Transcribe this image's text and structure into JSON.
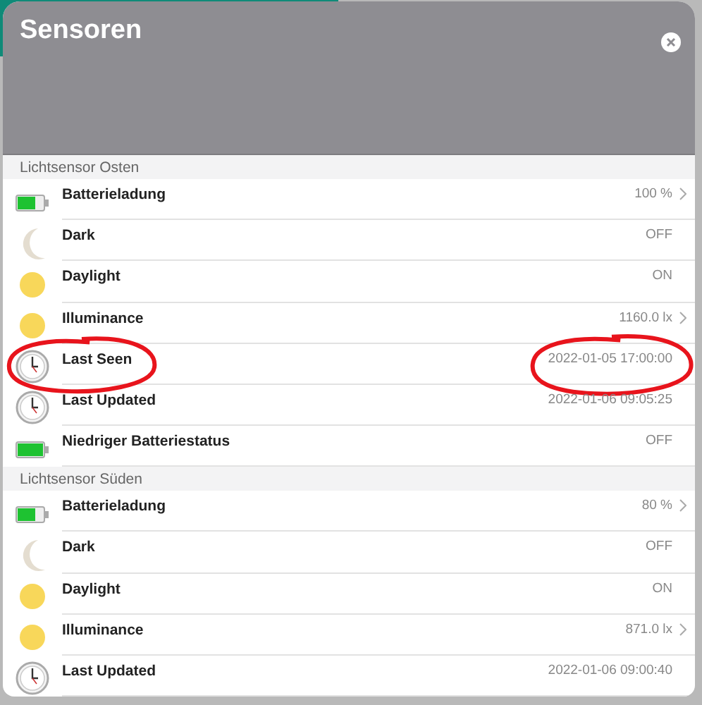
{
  "dialog": {
    "title": "Sensoren"
  },
  "sections": [
    {
      "title": "Lichtsensor Osten",
      "rows": [
        {
          "kind": "battery",
          "label": "Batterieladung",
          "value": "100 %",
          "more": true,
          "circled": false
        },
        {
          "kind": "moon",
          "label": "Dark",
          "value": "OFF",
          "more": false,
          "circled": false
        },
        {
          "kind": "sun",
          "label": "Daylight",
          "value": "ON",
          "more": false,
          "circled": false
        },
        {
          "kind": "sun",
          "label": "Illuminance",
          "value": "1160.0 lx",
          "more": true,
          "circled": false
        },
        {
          "kind": "clock",
          "label": "Last Seen",
          "value": "2022-01-05 17:00:00",
          "more": false,
          "circled": true
        },
        {
          "kind": "clock",
          "label": "Last Updated",
          "value": "2022-01-06 09:05:25",
          "more": false,
          "circled": false
        },
        {
          "kind": "battery_full",
          "label": "Niedriger Batteriestatus",
          "value": "OFF",
          "more": false,
          "circled": false
        }
      ]
    },
    {
      "title": "Lichtsensor Süden",
      "rows": [
        {
          "kind": "battery",
          "label": "Batterieladung",
          "value": "80 %",
          "more": true,
          "circled": false
        },
        {
          "kind": "moon",
          "label": "Dark",
          "value": "OFF",
          "more": false,
          "circled": false
        },
        {
          "kind": "sun",
          "label": "Daylight",
          "value": "ON",
          "more": false,
          "circled": false
        },
        {
          "kind": "sun",
          "label": "Illuminance",
          "value": "871.0 lx",
          "more": true,
          "circled": false
        },
        {
          "kind": "clock",
          "label": "Last Updated",
          "value": "2022-01-06 09:00:40",
          "more": false,
          "circled": false
        }
      ]
    }
  ]
}
